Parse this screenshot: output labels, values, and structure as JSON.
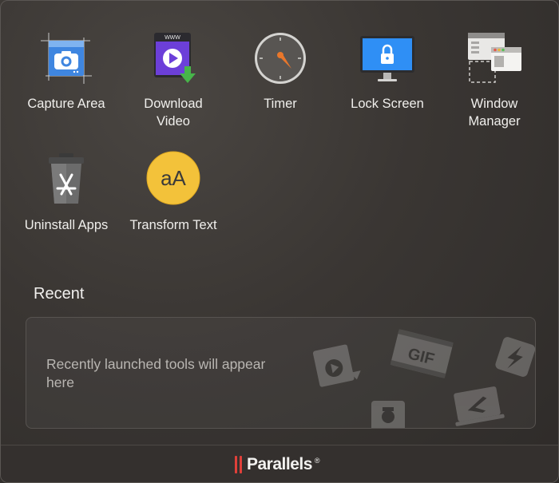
{
  "tools": [
    {
      "label": "Capture Area",
      "icon": "camera-screenshot-icon"
    },
    {
      "label": "Download\nVideo",
      "icon": "download-video-icon"
    },
    {
      "label": "Timer",
      "icon": "timer-icon"
    },
    {
      "label": "Lock Screen",
      "icon": "lock-screen-icon"
    },
    {
      "label": "Window\nManager",
      "icon": "window-manager-icon"
    },
    {
      "label": "Uninstall Apps",
      "icon": "trash-app-icon"
    },
    {
      "label": "Transform Text",
      "icon": "transform-text-icon"
    }
  ],
  "transform_text_glyph": "aA",
  "download_banner": "WWW",
  "recent": {
    "title": "Recent",
    "empty_message": "Recently launched tools will appear here",
    "deco_gif_label": "GIF"
  },
  "footer": {
    "brand": "Parallels",
    "registered": "®"
  },
  "colors": {
    "brand_red": "#e0403a",
    "accent_blue": "#2f8ff5",
    "timer_needle": "#e9772b",
    "transform_yellow": "#f3c23a"
  }
}
